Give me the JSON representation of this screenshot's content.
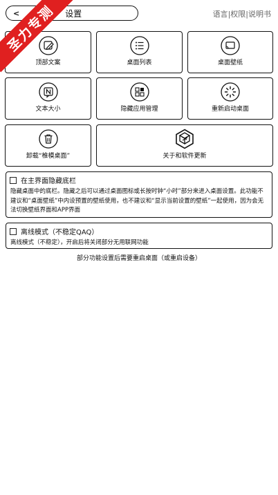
{
  "header": {
    "back_label": "设置",
    "links": [
      "语言",
      "权限",
      "说明书"
    ],
    "separator": "|"
  },
  "ribbon": {
    "text": "圣力专测",
    "color": "#e02020"
  },
  "tiles": [
    {
      "label": "顶部文案",
      "icon": "edit-icon"
    },
    {
      "label": "桌面列表",
      "icon": "list-icon"
    },
    {
      "label": "桌面壁纸",
      "icon": "cast-screen-icon"
    },
    {
      "label": "文本大小",
      "icon": "text-size-icon"
    },
    {
      "label": "隐藏应用管理",
      "icon": "apps-grid-icon"
    },
    {
      "label": "重新启动桌面",
      "icon": "loading-spinner-icon"
    },
    {
      "label": "卸载“椎模桌面”",
      "icon": "trash-icon"
    },
    {
      "label": "关于和软件更新",
      "icon": "app-logo-icon"
    }
  ],
  "options": [
    {
      "title": "在主界面隐藏底栏",
      "checked": false,
      "description": "隐藏桌面中的底栏。隐藏之后可以通过桌面图标或长按时钟“小时”部分来进入桌面设置。此功能不建议和“桌面壁纸”中内设预置的壁纸使用，也不建议和“显示当前设置的壁纸”一起使用，因为会无法切换壁纸界面和APP界面"
    },
    {
      "title": "离线模式（不稳定QAQ）",
      "checked": false,
      "description": "离线模式（不稳定），开启后将关闭部分无用联网功能"
    }
  ],
  "footnote": "部分功能设置后需要重启桌面（或重启设备）"
}
